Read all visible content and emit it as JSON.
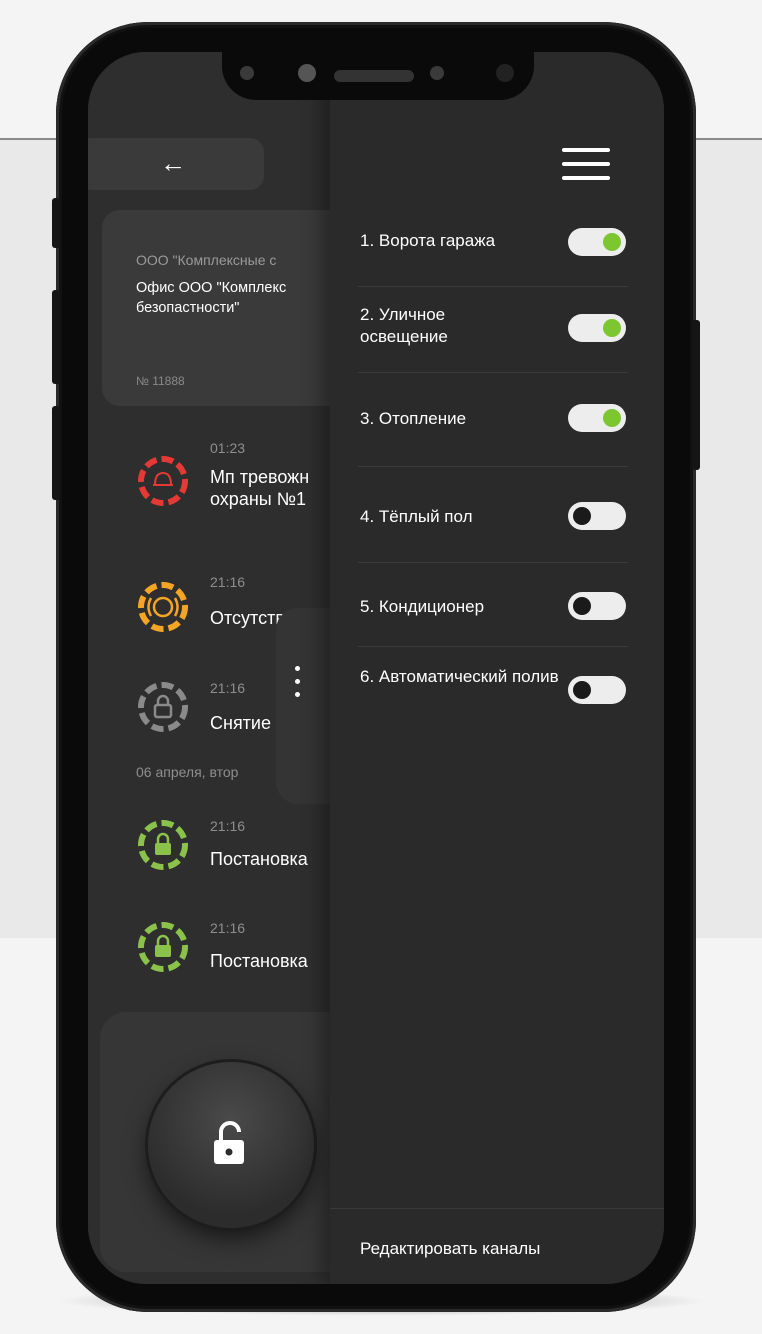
{
  "nav": {
    "back_icon": "arrow-left-icon",
    "menu_icon": "hamburger-menu-icon"
  },
  "object_card": {
    "company": "ООО \"Комплексные с",
    "object_name": "Офис ООО \"Комплекс безопастности\"",
    "number": "№ 11888"
  },
  "events": [
    {
      "time": "01:23",
      "text_line1": "Мп тревожн",
      "text_line2": "охраны №1",
      "status": "alarm",
      "color": "#e53935",
      "icon": "alarm-bell-icon"
    },
    {
      "time": "21:16",
      "text_line1": "Отсутств",
      "text_line2": "",
      "status": "warning",
      "color": "#f5a524",
      "icon": "fault-icon"
    },
    {
      "time": "21:16",
      "text_line1": "Снятие",
      "text_line2": "",
      "status": "disarmed",
      "color": "#8a8a8a",
      "icon": "lock-icon"
    },
    {
      "time": "21:16",
      "text_line1": "Постановка",
      "text_line2": "",
      "status": "armed",
      "color": "#8bc34a",
      "icon": "lock-icon"
    },
    {
      "time": "21:16",
      "text_line1": "Постановка",
      "text_line2": "",
      "status": "armed",
      "color": "#8bc34a",
      "icon": "lock-icon"
    }
  ],
  "date_separator": "06 апреля, втор",
  "channels": [
    {
      "label": "1. Ворота гаража",
      "on": true
    },
    {
      "label": "2. Уличное освещение",
      "on": true
    },
    {
      "label": "3. Отопление",
      "on": true
    },
    {
      "label": "4. Тёплый пол",
      "on": false
    },
    {
      "label": "5. Кондиционер",
      "on": false
    },
    {
      "label": "6. Автоматический полив",
      "on": false
    }
  ],
  "drawer_footer": {
    "edit_label": "Редактировать каналы"
  },
  "colors": {
    "accent_green": "#7cc630",
    "alarm_red": "#e53935",
    "warning_orange": "#f5a524"
  }
}
